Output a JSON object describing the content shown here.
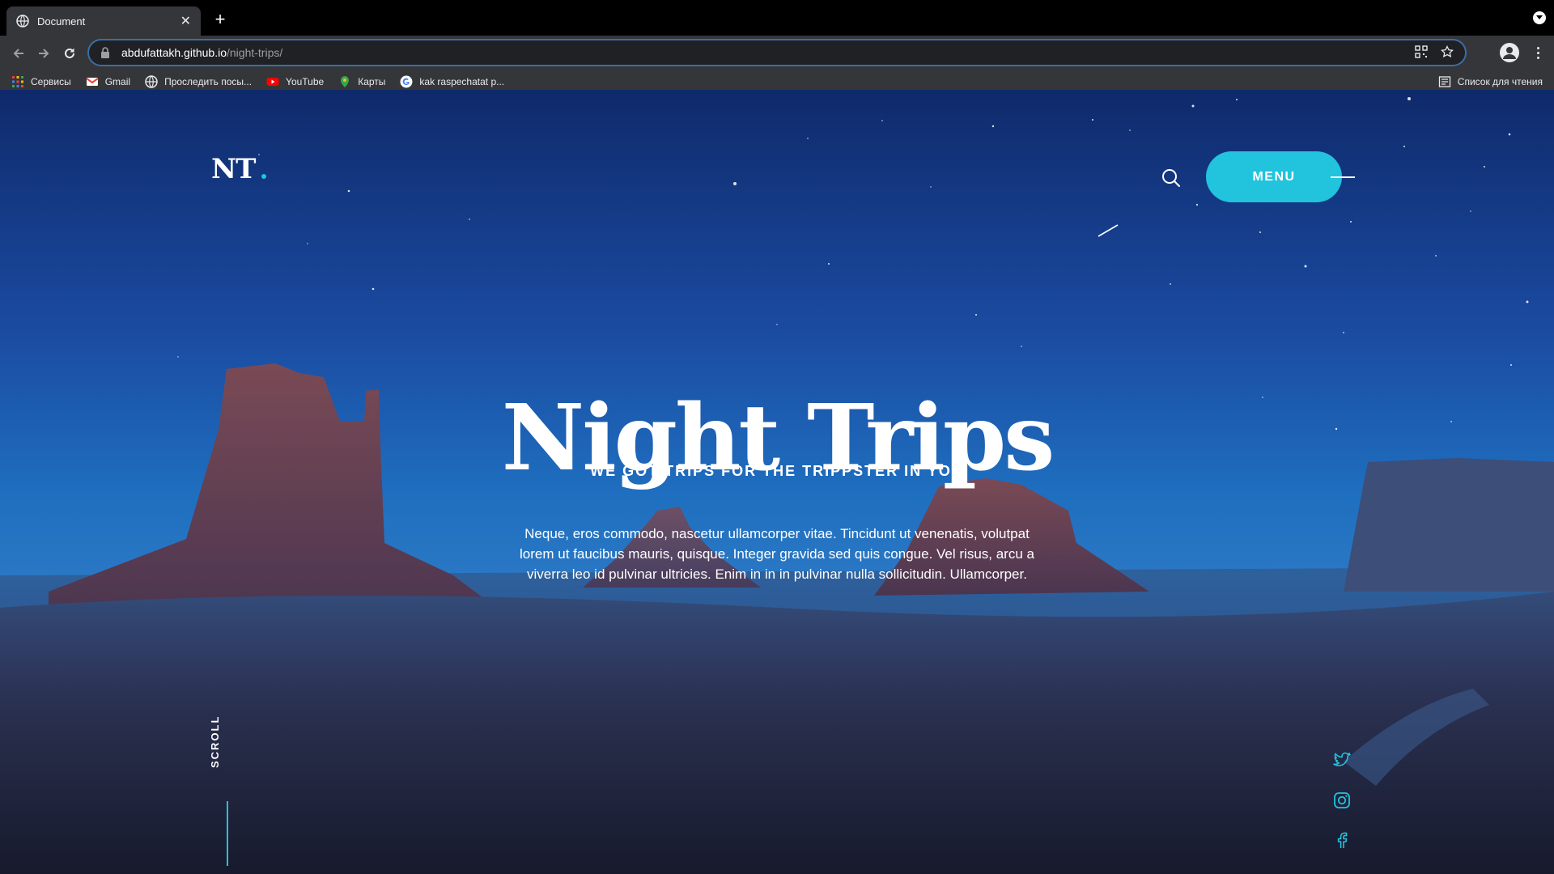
{
  "browser": {
    "tab_title": "Document",
    "tab_close": "✕",
    "new_tab": "+",
    "url_host": "abdufattakh.github.io",
    "url_path": "/night-trips/",
    "bookmarks": [
      {
        "label": "Сервисы",
        "icon": "apps-grid-icon"
      },
      {
        "label": "Gmail",
        "icon": "gmail-icon"
      },
      {
        "label": "Проследить посы...",
        "icon": "globe-icon"
      },
      {
        "label": "YouTube",
        "icon": "youtube-icon"
      },
      {
        "label": "Карты",
        "icon": "maps-pin-icon"
      },
      {
        "label": "kak raspechatat p...",
        "icon": "google-icon"
      }
    ],
    "reading_list": "Список для чтения"
  },
  "site": {
    "logo": "NT",
    "menu_label": "MENU",
    "accent_color": "#22c3dd"
  },
  "hero": {
    "title": "Night Trips",
    "subtitle": "WE GOT TRIPS FOR THE TRIPPSTER IN YOU",
    "body": "Neque, eros commodo, nascetur ullamcorper vitae. Tincidunt ut venenatis, volutpat lorem ut faucibus mauris, quisque. Integer gravida sed quis congue. Vel risus, arcu a viverra leo id pulvinar ultricies. Enim in in in pulvinar nulla sollicitudin. Ullamcorper."
  },
  "scroll": {
    "label": "SCROLL"
  },
  "social": [
    "twitter-icon",
    "instagram-icon",
    "facebook-icon"
  ]
}
